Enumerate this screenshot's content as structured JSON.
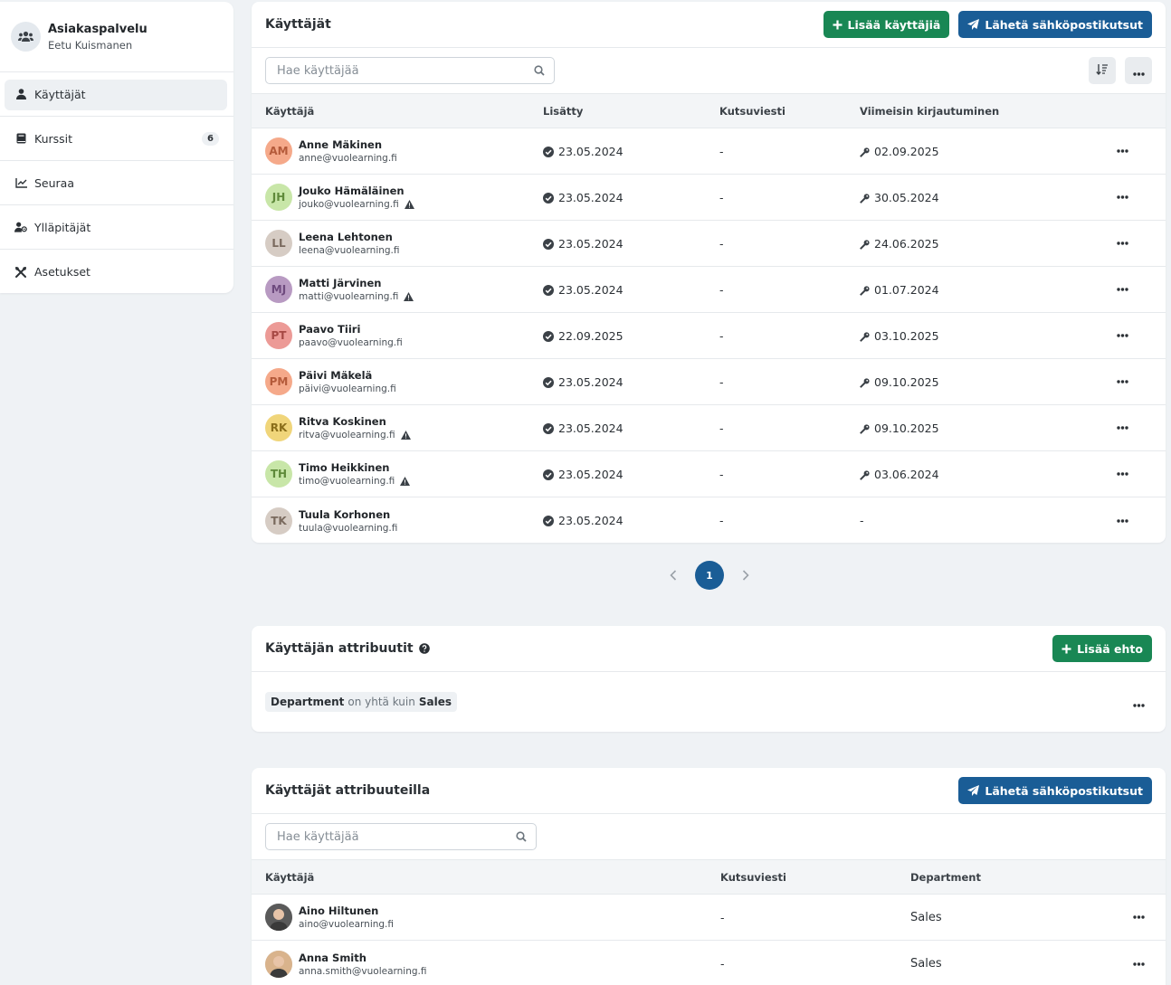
{
  "sidebar": {
    "org_name": "Asiakaspalvelu",
    "org_user": "Eetu Kuismanen",
    "items": [
      {
        "label": "Käyttäjät",
        "icon": "user-icon",
        "active": true
      },
      {
        "label": "Kurssit",
        "icon": "book-icon",
        "badge": "6"
      },
      {
        "label": "Seuraa",
        "icon": "chart-line-icon"
      },
      {
        "label": "Ylläpitäjät",
        "icon": "user-gear-icon"
      },
      {
        "label": "Asetukset",
        "icon": "tools-icon"
      }
    ]
  },
  "users_card": {
    "title": "Käyttäjät",
    "add_button": "Lisää käyttäjiä",
    "invite_button": "Lähetä sähköpostikutsut",
    "search_placeholder": "Hae käyttäjää",
    "columns": [
      "Käyttäjä",
      "Lisätty",
      "Kutsuviesti",
      "Viimeisin kirjautuminen"
    ],
    "rows": [
      {
        "initials": "AM",
        "name": "Anne Mäkinen",
        "email": "anne@vuolearning.fi",
        "warn": false,
        "added": "23.05.2024",
        "invite": "-",
        "last_login": "02.09.2025",
        "avatar_bg": "#f5a98a",
        "avatar_fg": "#b45a3a"
      },
      {
        "initials": "JH",
        "name": "Jouko Hämäläinen",
        "email": "jouko@vuolearning.fi",
        "warn": true,
        "added": "23.05.2024",
        "invite": "-",
        "last_login": "30.05.2024",
        "avatar_bg": "#c8e6a8",
        "avatar_fg": "#5f8a3a"
      },
      {
        "initials": "LL",
        "name": "Leena Lehtonen",
        "email": "leena@vuolearning.fi",
        "warn": false,
        "added": "23.05.2024",
        "invite": "-",
        "last_login": "24.06.2025",
        "avatar_bg": "#d6ccc4",
        "avatar_fg": "#7a6a5e"
      },
      {
        "initials": "MJ",
        "name": "Matti Järvinen",
        "email": "matti@vuolearning.fi",
        "warn": true,
        "added": "23.05.2024",
        "invite": "-",
        "last_login": "01.07.2024",
        "avatar_bg": "#b89ac2",
        "avatar_fg": "#6e4a7e"
      },
      {
        "initials": "PT",
        "name": "Paavo Tiiri",
        "email": "paavo@vuolearning.fi",
        "warn": false,
        "added": "22.09.2025",
        "invite": "-",
        "last_login": "03.10.2025",
        "avatar_bg": "#ec9a96",
        "avatar_fg": "#a64844"
      },
      {
        "initials": "PM",
        "name": "Päivi Mäkelä",
        "email": "päivi@vuolearning.fi",
        "warn": false,
        "added": "23.05.2024",
        "invite": "-",
        "last_login": "09.10.2025",
        "avatar_bg": "#f5a98a",
        "avatar_fg": "#b45a3a"
      },
      {
        "initials": "RK",
        "name": "Ritva Koskinen",
        "email": "ritva@vuolearning.fi",
        "warn": true,
        "added": "23.05.2024",
        "invite": "-",
        "last_login": "09.10.2025",
        "avatar_bg": "#f0d57a",
        "avatar_fg": "#8a6e1a"
      },
      {
        "initials": "TH",
        "name": "Timo Heikkinen",
        "email": "timo@vuolearning.fi",
        "warn": true,
        "added": "23.05.2024",
        "invite": "-",
        "last_login": "03.06.2024",
        "avatar_bg": "#c8e6a8",
        "avatar_fg": "#5f8a3a"
      },
      {
        "initials": "TK",
        "name": "Tuula Korhonen",
        "email": "tuula@vuolearning.fi",
        "warn": false,
        "added": "23.05.2024",
        "invite": "-",
        "last_login": "-",
        "avatar_bg": "#d6ccc4",
        "avatar_fg": "#7a6a5e"
      }
    ]
  },
  "pagination": {
    "current": "1"
  },
  "attributes_card": {
    "title": "Käyttäjän attribuutit",
    "add_button": "Lisää ehto",
    "condition": {
      "field": "Department",
      "operator": "on yhtä kuin",
      "value": "Sales"
    }
  },
  "attr_users_card": {
    "title": "Käyttäjät attribuuteilla",
    "invite_button": "Lähetä sähköpostikutsut",
    "search_placeholder": "Hae käyttäjää",
    "columns": [
      "Käyttäjä",
      "Kutsuviesti",
      "Department"
    ],
    "rows": [
      {
        "name": "Aino Hiltunen",
        "email": "aino@vuolearning.fi",
        "invite": "-",
        "department": "Sales",
        "photo_bg": "#5a5a5a"
      },
      {
        "name": "Anna Smith",
        "email": "anna.smith@vuolearning.fi",
        "invite": "-",
        "department": "Sales",
        "photo_bg": "#d9b38c"
      }
    ]
  }
}
